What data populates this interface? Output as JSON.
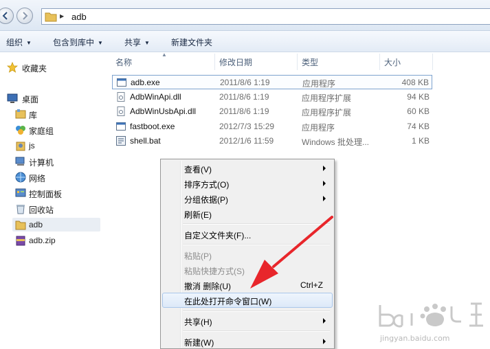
{
  "address": {
    "path": "adb"
  },
  "toolbar": {
    "organize": "组织",
    "include_library": "包含到库中",
    "share": "共享",
    "new_folder": "新建文件夹"
  },
  "nav": {
    "favorites": "收藏夹",
    "desktop": "桌面",
    "library": "库",
    "homegroup": "家庭组",
    "js": "js",
    "computer": "计算机",
    "network": "网络",
    "control_panel": "控制面板",
    "recycle_bin": "回收站",
    "adb": "adb",
    "adb_zip": "adb.zip"
  },
  "columns": {
    "name": "名称",
    "date": "修改日期",
    "type": "类型",
    "size": "大小"
  },
  "files": [
    {
      "name": "adb.exe",
      "date": "2011/8/6 1:19",
      "type": "应用程序",
      "size": "408 KB",
      "icon": "exe-icon"
    },
    {
      "name": "AdbWinApi.dll",
      "date": "2011/8/6 1:19",
      "type": "应用程序扩展",
      "size": "94 KB",
      "icon": "dll-icon"
    },
    {
      "name": "AdbWinUsbApi.dll",
      "date": "2011/8/6 1:19",
      "type": "应用程序扩展",
      "size": "60 KB",
      "icon": "dll-icon"
    },
    {
      "name": "fastboot.exe",
      "date": "2012/7/3 15:29",
      "type": "应用程序",
      "size": "74 KB",
      "icon": "exe-icon"
    },
    {
      "name": "shell.bat",
      "date": "2012/1/6 11:59",
      "type": "Windows 批处理...",
      "size": "1 KB",
      "icon": "bat-icon"
    }
  ],
  "context_menu": {
    "view": "查看(V)",
    "sort": "排序方式(O)",
    "group": "分组依据(P)",
    "refresh": "刷新(E)",
    "customize": "自定义文件夹(F)...",
    "paste": "粘贴(P)",
    "paste_shortcut": "粘贴快捷方式(S)",
    "undo": "撤消 删除(U)",
    "undo_shortcut": "Ctrl+Z",
    "open_cmd": "在此处打开命令窗口(W)",
    "share": "共享(H)",
    "new": "新建(W)"
  },
  "watermark": {
    "text": "jingyan.baidu.com"
  },
  "colors": {
    "selection_border": "#7da2ce",
    "highlight_border": "#a9c6ea",
    "annotation_arrow": "#e8262b"
  }
}
